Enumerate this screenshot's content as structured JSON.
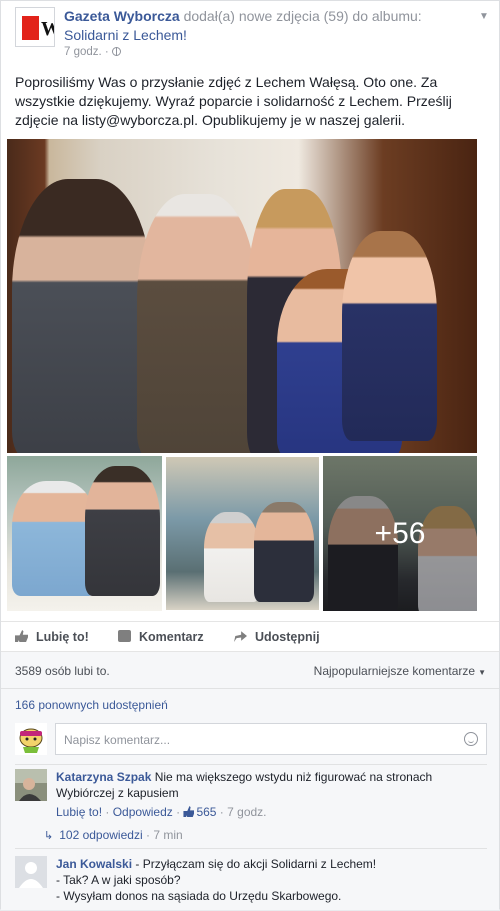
{
  "post": {
    "page_name": "Gazeta Wyborcza",
    "action_text": "dodał(a) nowe zdjęcia (59) do albumu:",
    "album_name": "Solidarni z Lechem!",
    "time": "7 godz.",
    "logo_letter": "W",
    "text": "Poprosiliśmy Was o przysłanie zdjęć z Lechem Wałęsą. Oto one. Za wszystkie dziękujemy. Wyraź poparcie i solidarność z Lechem. Prześlij zdjęcie na listy@wyborcza.pl. Opublikujemy je w naszej galerii.",
    "more_photos_count": "+56"
  },
  "actions": {
    "like": "Lubię to!",
    "comment": "Komentarz",
    "share": "Udostępnij"
  },
  "feedback": {
    "likes": "3589 osób lubi to.",
    "sort": "Najpopularniejsze komentarze",
    "shares": "166 ponownych udostępnień",
    "comment_placeholder": "Napisz komentarz..."
  },
  "comments": [
    {
      "author": "Katarzyna Szpak",
      "text": "Nie ma większego wstydu niż figurować na stronach Wybiórczej z kapusiem",
      "like_label": "Lubię to!",
      "reply_label": "Odpowiedz",
      "like_count": "565",
      "time": "7 godz.",
      "replies": "102 odpowiedzi",
      "replies_time": "7 min"
    },
    {
      "author": "Jan Kowalski",
      "line1": "- Przyłączam się do akcji Solidarni z Lechem!",
      "line2": "- Tak? A w jaki sposób?",
      "line3": "- Wysyłam donos na sąsiada do Urzędu Skarbowego."
    }
  ],
  "colors": {
    "link": "#3b5998",
    "brand_red": "#e2231a"
  }
}
